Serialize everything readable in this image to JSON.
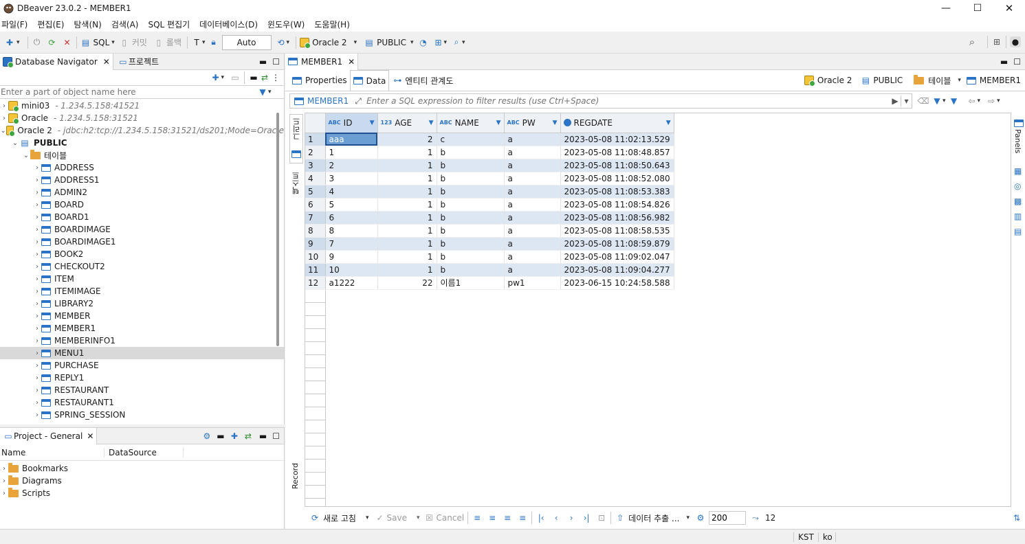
{
  "window": {
    "title": "DBeaver 23.0.2 - MEMBER1"
  },
  "menu": [
    "파일(F)",
    "편집(E)",
    "탐색(N)",
    "검색(A)",
    "SQL 편집기",
    "데이터베이스(D)",
    "윈도우(W)",
    "도움말(H)"
  ],
  "toolbar": {
    "sql": "SQL",
    "commit": "커밋",
    "rollback": "롤백",
    "auto": "Auto",
    "datasource": "Oracle 2",
    "schema": "PUBLIC"
  },
  "navigator": {
    "tab_label": "Database Navigator",
    "project_tab": "프로젝트",
    "filter_placeholder": "Enter a part of object name here",
    "connections": [
      {
        "name": "mini03",
        "url": "- 1.234.5.158:41521"
      },
      {
        "name": "Oracle",
        "url": "- 1.234.5.158:31521"
      },
      {
        "name": "Oracle 2",
        "url": "- jdbc:h2:tcp://1.234.5.158:31521/ds201;Mode=Oracle"
      }
    ],
    "schema": "PUBLIC",
    "tables_folder": "테이블",
    "tables": [
      "ADDRESS",
      "ADDRESS1",
      "ADMIN2",
      "BOARD",
      "BOARD1",
      "BOARDIMAGE",
      "BOARDIMAGE1",
      "BOOK2",
      "CHECKOUT2",
      "ITEM",
      "ITEMIMAGE",
      "LIBRARY2",
      "MEMBER",
      "MEMBER1",
      "MEMBERINFO1",
      "MENU1",
      "PURCHASE",
      "REPLY1",
      "RESTAURANT",
      "RESTAURANT1",
      "SPRING_SESSION"
    ],
    "selected_table": "MENU1"
  },
  "project": {
    "tab_label": "Project - General",
    "col_name": "Name",
    "col_datasource": "DataSource",
    "items": [
      "Bookmarks",
      "Diagrams",
      "Scripts"
    ]
  },
  "editor": {
    "tab_label": "MEMBER1",
    "subtabs": [
      "Properties",
      "Data",
      "엔티티 관계도"
    ],
    "crumbs": [
      "Oracle 2",
      "PUBLIC",
      "테이블",
      "MEMBER1"
    ],
    "filter_table": "MEMBER1",
    "filter_placeholder": "Enter a SQL expression to filter results (use Ctrl+Space)",
    "side_left": [
      "그리드",
      "텍스트",
      "Record"
    ],
    "side_right": "Panels"
  },
  "grid": {
    "columns": [
      {
        "type": "ABC",
        "name": "ID"
      },
      {
        "type": "123",
        "name": "AGE"
      },
      {
        "type": "ABC",
        "name": "NAME"
      },
      {
        "type": "ABC",
        "name": "PW"
      },
      {
        "type": "clock",
        "name": "REGDATE"
      }
    ],
    "rows": [
      [
        "1",
        "aaa",
        "2",
        "c",
        "a",
        "2023-05-08 11:02:13.529"
      ],
      [
        "2",
        "1",
        "1",
        "b",
        "a",
        "2023-05-08 11:08:48.857"
      ],
      [
        "3",
        "2",
        "1",
        "b",
        "a",
        "2023-05-08 11:08:50.643"
      ],
      [
        "4",
        "3",
        "1",
        "b",
        "a",
        "2023-05-08 11:08:52.080"
      ],
      [
        "5",
        "4",
        "1",
        "b",
        "a",
        "2023-05-08 11:08:53.383"
      ],
      [
        "6",
        "5",
        "1",
        "b",
        "a",
        "2023-05-08 11:08:54.826"
      ],
      [
        "7",
        "6",
        "1",
        "b",
        "a",
        "2023-05-08 11:08:56.982"
      ],
      [
        "8",
        "8",
        "1",
        "b",
        "a",
        "2023-05-08 11:08:58.535"
      ],
      [
        "9",
        "7",
        "1",
        "b",
        "a",
        "2023-05-08 11:08:59.879"
      ],
      [
        "10",
        "9",
        "1",
        "b",
        "a",
        "2023-05-08 11:09:02.047"
      ],
      [
        "11",
        "10",
        "1",
        "b",
        "a",
        "2023-05-08 11:09:04.277"
      ],
      [
        "12",
        "a1222",
        "22",
        "이름1",
        "pw1",
        "2023-06-15 10:24:58.588"
      ]
    ]
  },
  "bottom": {
    "refresh": "새로 고침",
    "save": "Save",
    "cancel": "Cancel",
    "export": "데이터 추출 ...",
    "fetch_size": "200",
    "row_count": "12"
  },
  "status": {
    "timezone": "KST",
    "locale": "ko"
  },
  "colors": {
    "accent": "#2a73c5",
    "row_alt": "#dde6f3",
    "selected_cell": "#6b9fd4"
  }
}
